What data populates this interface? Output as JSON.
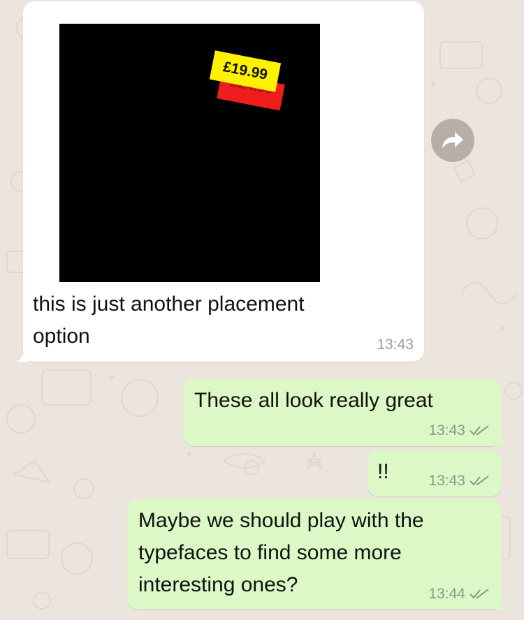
{
  "chat": {
    "messages": [
      {
        "direction": "incoming",
        "type": "image",
        "caption_line1": "this is just another placement",
        "caption_line2": "option",
        "time": "13:43",
        "image": {
          "price_new": "£19.99",
          "price_old": "£24.99"
        }
      },
      {
        "direction": "outgoing",
        "text": "These all look really great",
        "time": "13:43",
        "status": "read"
      },
      {
        "direction": "outgoing",
        "text": "!!",
        "time": "13:43",
        "status": "read"
      },
      {
        "direction": "outgoing",
        "line1": "Maybe we should play with the",
        "line2": "typefaces to find some more",
        "line3": "interesting ones?",
        "time": "13:44",
        "status": "read"
      }
    ]
  },
  "icons": {
    "forward": "forward-icon",
    "read_receipt": "double-check-icon"
  },
  "colors": {
    "chat_background": "#ece5dd",
    "incoming_bubble": "#ffffff",
    "outgoing_bubble": "#dcf8c6",
    "price_tag_new": "#fff200",
    "price_tag_old": "#ef1d1d"
  }
}
